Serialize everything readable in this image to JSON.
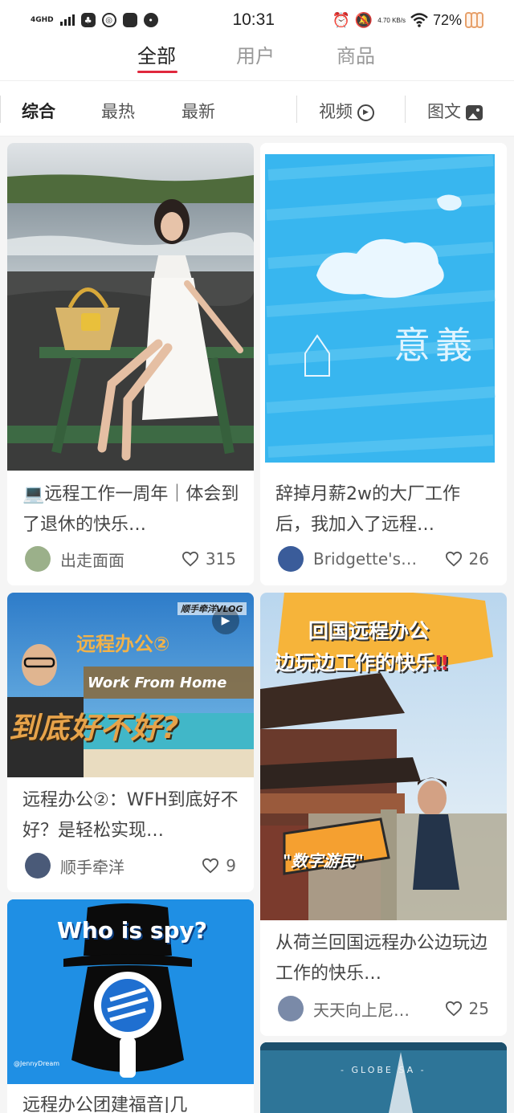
{
  "status_bar": {
    "network": "4GHD",
    "time": "10:31",
    "speed": "4.70 KB/s",
    "battery": "72%",
    "icons": [
      "signal-icon",
      "notification-icon",
      "app-icon",
      "app-icon",
      "message-icon",
      "alarm-icon",
      "mute-icon",
      "wifi-icon",
      "battery-icon"
    ]
  },
  "main_tabs": [
    {
      "label": "全部",
      "active": true
    },
    {
      "label": "用户",
      "active": false
    },
    {
      "label": "商品",
      "active": false
    }
  ],
  "filters": {
    "sort": [
      {
        "label": "综合",
        "active": true
      },
      {
        "label": "最热",
        "active": false
      },
      {
        "label": "最新",
        "active": false
      }
    ],
    "video_label": "视频",
    "image_label": "图文"
  },
  "cards": [
    {
      "title": "💻远程工作一周年｜体会到了退休的快乐…",
      "author": "出走面面",
      "likes": "315",
      "avatar_color": "#9bb08a"
    },
    {
      "title": "辞掉月薪2w的大厂工作后，我加入了远程…",
      "author": "Bridgette's…",
      "likes": "26",
      "avatar_color": "#3a5c9a",
      "cover_text": "意義"
    },
    {
      "title": "远程办公②：WFH到底好不好？是轻松实现…",
      "author": "顺手牵洋",
      "likes": "9",
      "avatar_color": "#4a5a78",
      "cover_lines": [
        "远程办公②",
        "Work From Home",
        "到底好不好?"
      ],
      "cover_tag": "顺手牵洋VLOG"
    },
    {
      "title": "从荷兰回国远程办公边玩边工作的快乐…",
      "author": "天天向上尼…",
      "likes": "25",
      "avatar_color": "#7a8aa8",
      "cover_lines": [
        "回国远程办公",
        "边玩边工作的快乐",
        "\"数字游民\""
      ],
      "cover_mark": "‼"
    },
    {
      "title": "远程办公团建福音|几",
      "author": "",
      "likes": "",
      "cover_lines": [
        "Who is spy?",
        "@JennyDream"
      ]
    },
    {
      "title": "",
      "author": "",
      "likes": "",
      "cover_lines": [
        "- GLOBE SA -"
      ]
    }
  ],
  "colors": {
    "accent": "#e0283d",
    "text": "#333333",
    "muted": "#999999"
  }
}
